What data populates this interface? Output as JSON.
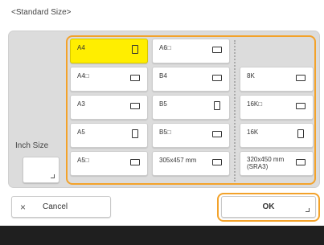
{
  "dialog": {
    "title": "<Standard Size>",
    "inch_size_label": "Inch Size",
    "cancel_label": "Cancel",
    "ok_label": "OK"
  },
  "paper_sizes": [
    {
      "label": "A4",
      "orientation": "portrait",
      "selected": true
    },
    {
      "label": "A6□",
      "orientation": "landscape",
      "selected": false
    },
    {
      "label": "A4□",
      "orientation": "landscape",
      "selected": false
    },
    {
      "label": "B4",
      "orientation": "landscape",
      "selected": false
    },
    {
      "label": "8K",
      "orientation": "landscape",
      "selected": false
    },
    {
      "label": "A3",
      "orientation": "landscape",
      "selected": false
    },
    {
      "label": "B5",
      "orientation": "portrait",
      "selected": false
    },
    {
      "label": "16K□",
      "orientation": "landscape",
      "selected": false
    },
    {
      "label": "A5",
      "orientation": "portrait",
      "selected": false
    },
    {
      "label": "B5□",
      "orientation": "landscape",
      "selected": false
    },
    {
      "label": "16K",
      "orientation": "portrait",
      "selected": false
    },
    {
      "label": "A5□",
      "orientation": "landscape",
      "selected": false
    },
    {
      "label": "305x457 mm",
      "orientation": "landscape",
      "selected": false
    },
    {
      "label": "320x450 mm\n(SRA3)",
      "orientation": "landscape",
      "selected": false
    }
  ],
  "colors": {
    "selected": "#ffee00",
    "focus_outline": "#f3a22a",
    "panel": "#dcdcdc",
    "bottom_bar": "#1f1f1f"
  }
}
